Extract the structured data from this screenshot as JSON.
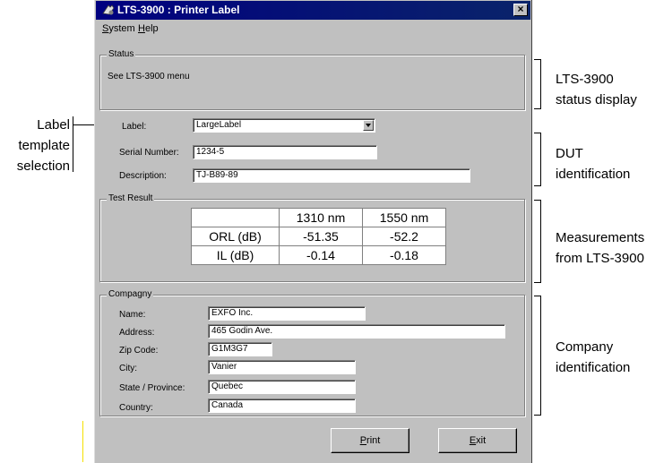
{
  "window": {
    "title": "LTS-3900 : Printer Label",
    "close_label": "×"
  },
  "menu": {
    "system_first": "S",
    "system_rest": "ystem",
    "help_first": "H",
    "help_rest": "elp"
  },
  "status_group": {
    "title": "Status",
    "text": "See LTS-3900 menu"
  },
  "label": {
    "label": "Label:",
    "value": "LargeLabel"
  },
  "serial": {
    "label": "Serial Number:",
    "value": "1234-5"
  },
  "description": {
    "label": "Description:",
    "value": "TJ-B89-89"
  },
  "test_result": {
    "title": "Test Result",
    "columns": [
      "1310 nm",
      "1550 nm"
    ],
    "rows": [
      {
        "label": "ORL (dB)",
        "values": [
          "-51.35",
          "-52.2"
        ]
      },
      {
        "label": "IL (dB)",
        "values": [
          "-0.14",
          "-0.18"
        ]
      }
    ]
  },
  "company": {
    "title": "Compagny",
    "fields": [
      {
        "label": "Name:",
        "value": "EXFO Inc."
      },
      {
        "label": "Address:",
        "value": "465 Godin Ave."
      },
      {
        "label": "Zip Code:",
        "value": "G1M3G7"
      },
      {
        "label": "City:",
        "value": "Vanier"
      },
      {
        "label": "State / Province:",
        "value": "Quebec"
      },
      {
        "label": "Country:",
        "value": "Canada"
      }
    ]
  },
  "buttons": {
    "print_first": "P",
    "print_rest": "rint",
    "exit_first": "E",
    "exit_rest": "xit"
  },
  "annotations": {
    "left": [
      "Label",
      "template",
      "selection"
    ],
    "status": [
      "LTS-3900",
      "status display"
    ],
    "dut": [
      "DUT",
      "identification"
    ],
    "measure": [
      "Measurements",
      "from LTS-3900"
    ],
    "company": [
      "Company",
      "identification"
    ]
  },
  "colors": {
    "titlebar": "#000080",
    "window": "#c0c0c0",
    "marker": "#f5e000"
  }
}
